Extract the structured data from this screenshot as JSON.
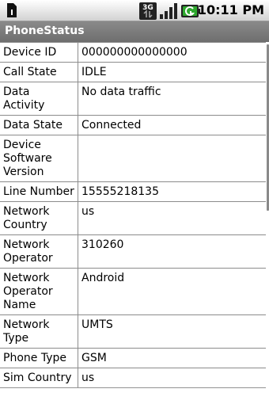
{
  "status_bar": {
    "time": "10:11 PM",
    "icons": [
      "sim-card-icon",
      "3g-data-icon",
      "signal-strength-icon",
      "battery-charging-icon"
    ]
  },
  "app": {
    "title": "PhoneStatus"
  },
  "rows": [
    {
      "label": "Device ID",
      "value": "000000000000000"
    },
    {
      "label": "Call State",
      "value": "IDLE"
    },
    {
      "label": "Data Activity",
      "value": "No data traffic"
    },
    {
      "label": "Data State",
      "value": "Connected"
    },
    {
      "label": "Device Software Version",
      "value": ""
    },
    {
      "label": "Line Number",
      "value": "15555218135"
    },
    {
      "label": "Network Country",
      "value": "us"
    },
    {
      "label": "Network Operator",
      "value": "310260"
    },
    {
      "label": "Network Operator Name",
      "value": "Android"
    },
    {
      "label": "Network Type",
      "value": "UMTS"
    },
    {
      "label": "Phone Type",
      "value": "GSM"
    },
    {
      "label": "Sim Country",
      "value": "us"
    }
  ],
  "colors": {
    "status_bar_bg": "#e8e8e8",
    "title_bar_bg": "#7a7a7a",
    "battery_green": "#2ea82e"
  }
}
